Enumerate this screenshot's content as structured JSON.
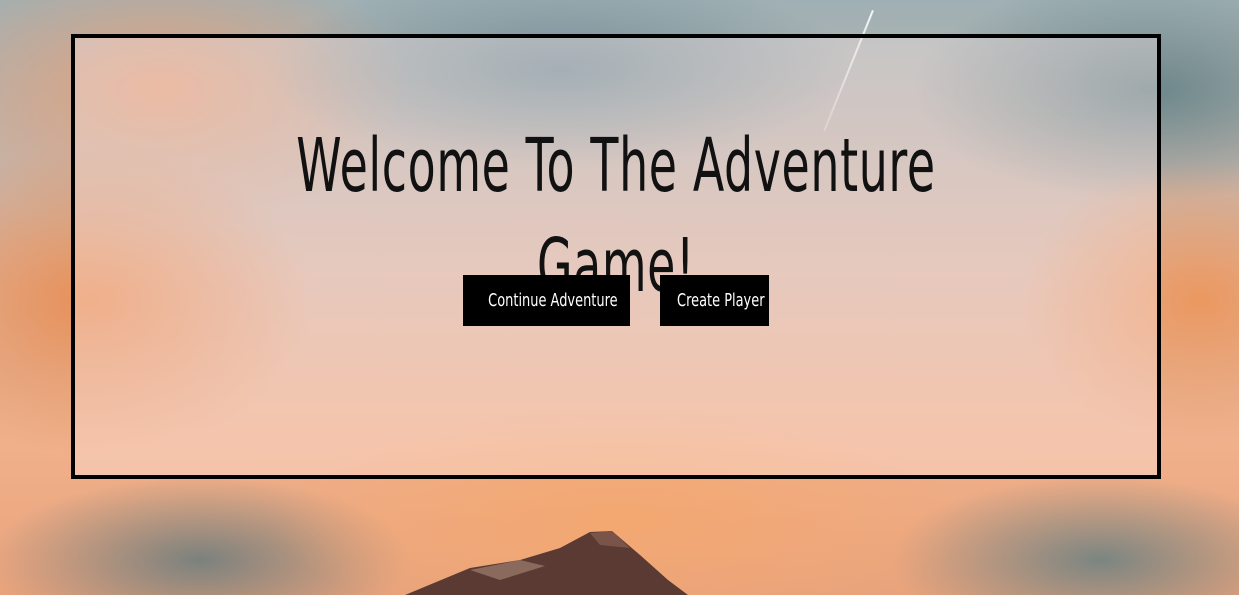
{
  "page": {
    "title": "Welcome To The Adventure Game!"
  },
  "actions": {
    "continue_label": "Continue Adventure",
    "create_label": "Create Player"
  },
  "colors": {
    "panel_border": "#000000",
    "button_bg": "#000000",
    "button_text": "#ffffff",
    "title_text": "#111111"
  }
}
